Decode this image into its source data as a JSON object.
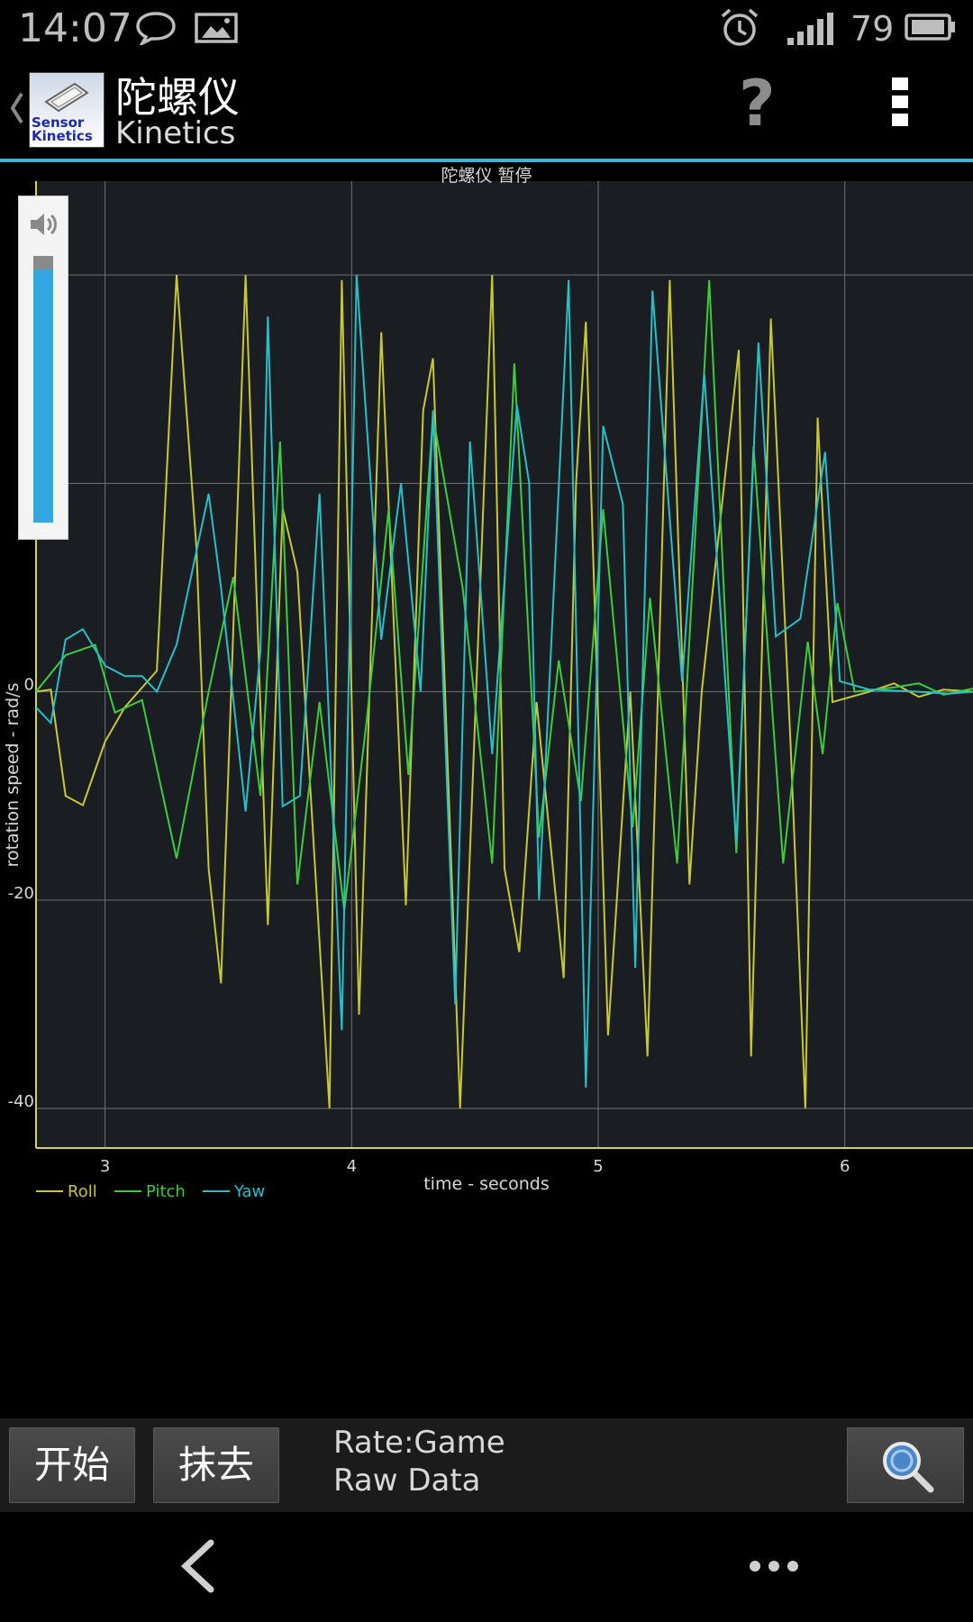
{
  "status_bar": {
    "time": "14:07",
    "battery_level": "79",
    "icons": [
      "chat-bubble-icon",
      "image-icon",
      "alarm-clock-icon",
      "signal-icon",
      "battery-icon"
    ]
  },
  "action_bar": {
    "title": "陀螺仪",
    "subtitle": "Kinetics",
    "app_icon_text": "Sensor Kinetics",
    "help_label": "?"
  },
  "volume": {
    "level": 0.95
  },
  "toolbar": {
    "start_label": "开始",
    "clear_label": "抹去",
    "rate_label": "Rate:Game",
    "mode_label": "Raw Data"
  },
  "colors": {
    "accent": "#33b5e5",
    "roll": "#c8c832",
    "pitch": "#3ccc3c",
    "yaw": "#28c0c8",
    "axis": "#d4d44a"
  },
  "chart_data": {
    "type": "line",
    "title": "陀螺仪 暂停",
    "xlabel": "time - seconds",
    "ylabel": "rotation speed - rad/s",
    "xlim": [
      2.72,
      6.52
    ],
    "ylim": [
      -43.8,
      49
    ],
    "x_ticks": [
      3,
      4,
      5,
      6
    ],
    "y_ticks": [
      0,
      -20,
      -40
    ],
    "y_tick_labels": [
      "0",
      "-20",
      "-40"
    ],
    "grid": true,
    "legend": "bottom-left",
    "series": [
      {
        "name": "Roll",
        "points": [
          [
            2.72,
            0
          ],
          [
            2.78,
            0.2
          ],
          [
            2.84,
            -10
          ],
          [
            2.91,
            -10.9
          ],
          [
            3.0,
            -4.8
          ],
          [
            3.08,
            -1.5
          ],
          [
            3.21,
            2
          ],
          [
            3.29,
            40
          ],
          [
            3.37,
            14
          ],
          [
            3.42,
            -17
          ],
          [
            3.47,
            -28
          ],
          [
            3.57,
            40
          ],
          [
            3.66,
            -22.4
          ],
          [
            3.72,
            17.6
          ],
          [
            3.78,
            11.5
          ],
          [
            3.91,
            -40
          ],
          [
            3.96,
            39.5
          ],
          [
            4.03,
            -31
          ],
          [
            4.12,
            34.5
          ],
          [
            4.22,
            -20.5
          ],
          [
            4.29,
            27
          ],
          [
            4.33,
            32
          ],
          [
            4.44,
            -40
          ],
          [
            4.57,
            40
          ],
          [
            4.62,
            -17
          ],
          [
            4.68,
            -25
          ],
          [
            4.75,
            -1
          ],
          [
            4.86,
            -27.5
          ],
          [
            4.91,
            20
          ],
          [
            4.95,
            35.5
          ],
          [
            5.04,
            -33
          ],
          [
            5.13,
            0
          ],
          [
            5.2,
            -35
          ],
          [
            5.29,
            39.5
          ],
          [
            5.37,
            -18.5
          ],
          [
            5.42,
            0
          ],
          [
            5.57,
            32.8
          ],
          [
            5.62,
            -35
          ],
          [
            5.7,
            35.8
          ],
          [
            5.78,
            -5
          ],
          [
            5.84,
            -40
          ],
          [
            5.89,
            26.3
          ],
          [
            5.95,
            -1
          ],
          [
            6.1,
            0
          ],
          [
            6.2,
            0.8
          ],
          [
            6.3,
            -0.5
          ],
          [
            6.4,
            0.2
          ],
          [
            6.52,
            0
          ]
        ]
      },
      {
        "name": "Pitch",
        "points": [
          [
            2.72,
            0
          ],
          [
            2.84,
            3.5
          ],
          [
            2.96,
            4.5
          ],
          [
            3.04,
            -2
          ],
          [
            3.15,
            -0.8
          ],
          [
            3.29,
            -16
          ],
          [
            3.42,
            0
          ],
          [
            3.52,
            11
          ],
          [
            3.63,
            -10
          ],
          [
            3.71,
            24
          ],
          [
            3.78,
            -18.5
          ],
          [
            3.87,
            -1
          ],
          [
            3.97,
            -21
          ],
          [
            4.06,
            -3
          ],
          [
            4.15,
            17.5
          ],
          [
            4.23,
            -8
          ],
          [
            4.33,
            26.5
          ],
          [
            4.45,
            10
          ],
          [
            4.57,
            -16.5
          ],
          [
            4.66,
            31.5
          ],
          [
            4.76,
            -14
          ],
          [
            4.84,
            3
          ],
          [
            4.93,
            -10.5
          ],
          [
            5.02,
            17.5
          ],
          [
            5.14,
            -13
          ],
          [
            5.21,
            9
          ],
          [
            5.32,
            -16.5
          ],
          [
            5.45,
            39.5
          ],
          [
            5.56,
            -15.5
          ],
          [
            5.63,
            23.5
          ],
          [
            5.75,
            -16.5
          ],
          [
            5.85,
            4.8
          ],
          [
            5.91,
            -6
          ],
          [
            5.97,
            8.5
          ],
          [
            6.04,
            0
          ],
          [
            6.2,
            0.4
          ],
          [
            6.3,
            0.8
          ],
          [
            6.4,
            -0.3
          ],
          [
            6.52,
            0.3
          ]
        ]
      },
      {
        "name": "Yaw",
        "points": [
          [
            2.72,
            -1.5
          ],
          [
            2.78,
            -3
          ],
          [
            2.84,
            5
          ],
          [
            2.91,
            6
          ],
          [
            3.0,
            2.5
          ],
          [
            3.08,
            1.5
          ],
          [
            3.15,
            1.5
          ],
          [
            3.21,
            0
          ],
          [
            3.29,
            4.5
          ],
          [
            3.42,
            19
          ],
          [
            3.47,
            10
          ],
          [
            3.57,
            -11.5
          ],
          [
            3.63,
            4
          ],
          [
            3.66,
            36
          ],
          [
            3.72,
            -11
          ],
          [
            3.79,
            -10
          ],
          [
            3.87,
            19
          ],
          [
            3.96,
            -32.5
          ],
          [
            4.02,
            40
          ],
          [
            4.12,
            5
          ],
          [
            4.2,
            20
          ],
          [
            4.28,
            0
          ],
          [
            4.33,
            27
          ],
          [
            4.42,
            -30
          ],
          [
            4.48,
            24
          ],
          [
            4.57,
            -6
          ],
          [
            4.67,
            27.5
          ],
          [
            4.72,
            20
          ],
          [
            4.76,
            -20
          ],
          [
            4.88,
            39.5
          ],
          [
            4.95,
            -38
          ],
          [
            5.02,
            25.5
          ],
          [
            5.1,
            18
          ],
          [
            5.15,
            -26.5
          ],
          [
            5.22,
            38.5
          ],
          [
            5.34,
            1
          ],
          [
            5.43,
            30.5
          ],
          [
            5.56,
            -14.5
          ],
          [
            5.65,
            33.5
          ],
          [
            5.72,
            5.3
          ],
          [
            5.82,
            7
          ],
          [
            5.92,
            23
          ],
          [
            5.98,
            1
          ],
          [
            6.1,
            0.2
          ],
          [
            6.3,
            0
          ],
          [
            6.42,
            -0.2
          ],
          [
            6.52,
            0
          ]
        ]
      }
    ]
  }
}
